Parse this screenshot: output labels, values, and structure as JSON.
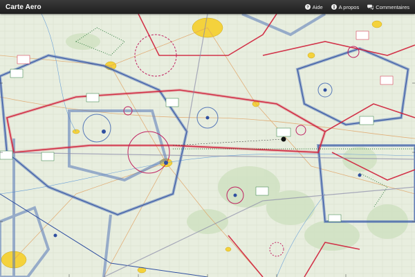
{
  "app": {
    "title": "Carte Aero"
  },
  "nav": {
    "help_label": "Aide",
    "about_label": "A propos",
    "comments_label": "Commentaires"
  },
  "icons": {
    "help": "question-circle-icon",
    "about": "info-circle-icon",
    "comments": "speech-bubbles-icon"
  },
  "colors": {
    "topbar": "#2a2a2a",
    "airspace_red": "#d0203a",
    "airspace_blue": "#5577b8",
    "map_green": "#dfe9d2"
  }
}
